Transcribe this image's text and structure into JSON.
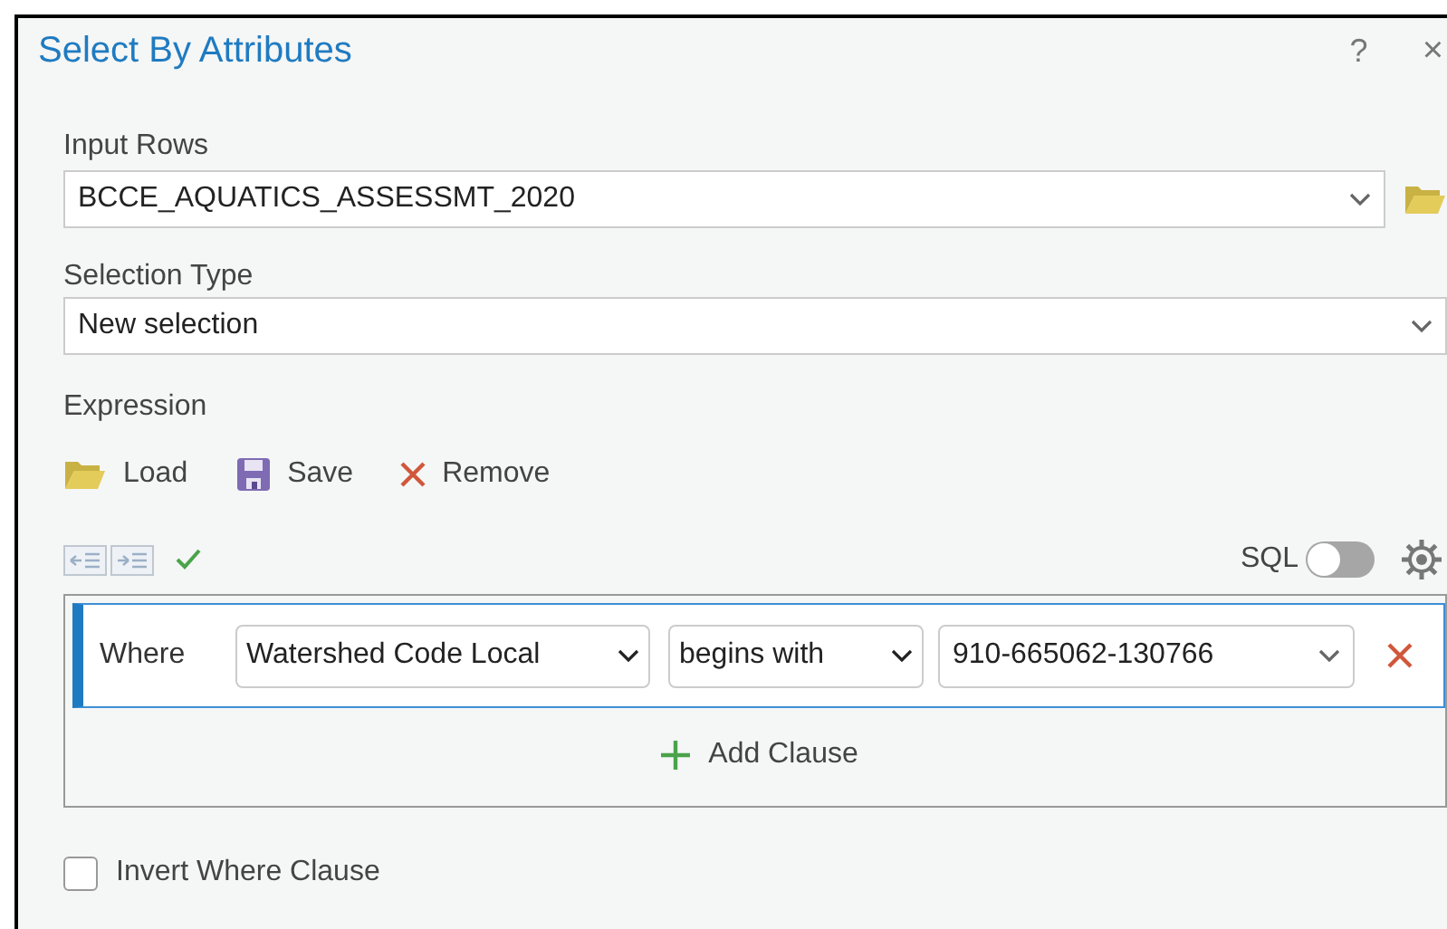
{
  "window": {
    "title": "Select By Attributes",
    "help": "?",
    "close": "×"
  },
  "input_rows": {
    "label": "Input Rows",
    "value": "BCCE_AQUATICS_ASSESSMT_2020"
  },
  "selection_type": {
    "label": "Selection Type",
    "value": "New selection"
  },
  "expression": {
    "label": "Expression",
    "actions": [
      {
        "kind": "load",
        "label": "Load"
      },
      {
        "kind": "save",
        "label": "Save"
      },
      {
        "kind": "remove",
        "label": "Remove"
      }
    ],
    "sql_toggle": {
      "label": "SQL",
      "on": false
    },
    "clauses": [
      {
        "connector": "Where",
        "field": "Watershed Code Local",
        "operator": "begins with",
        "value": "910-665062-130766",
        "selected": true
      }
    ],
    "add_clause": "Add Clause"
  },
  "invert": {
    "label": "Invert Where Clause",
    "checked": false
  }
}
